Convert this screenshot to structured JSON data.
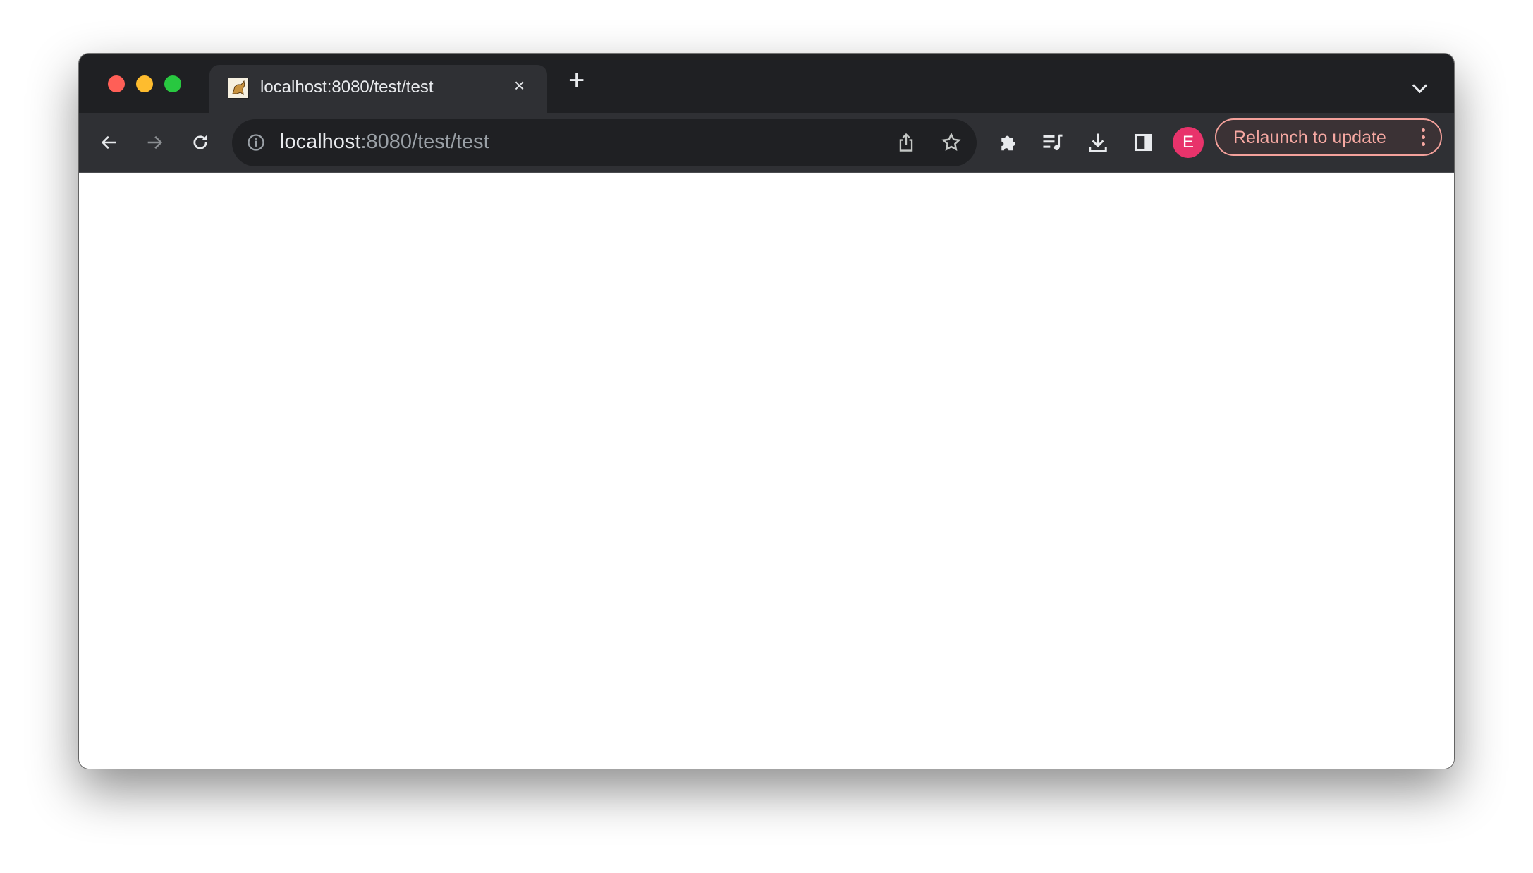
{
  "window": {
    "traffic_lights": [
      {
        "name": "close",
        "color": "#ff5f57"
      },
      {
        "name": "minimize",
        "color": "#febc2e"
      },
      {
        "name": "zoom",
        "color": "#28c840"
      }
    ]
  },
  "tab": {
    "title": "localhost:8080/test/test",
    "favicon": "tomcat-icon",
    "close_icon": "×"
  },
  "new_tab_icon": "+",
  "toolbar": {
    "url_host": "localhost",
    "url_path": ":8080/test/test",
    "avatar_letter": "E",
    "avatar_color": "#e8336b",
    "relaunch_label": "Relaunch to update",
    "relaunch_color": "#f4a19b"
  }
}
